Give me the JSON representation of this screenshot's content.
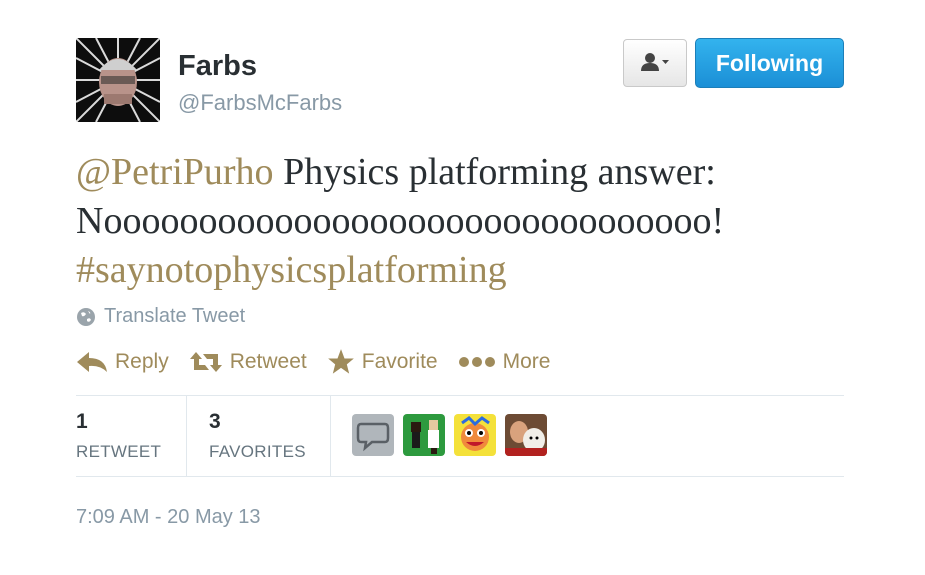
{
  "author": {
    "name": "Farbs",
    "handle": "@FarbsMcFarbs"
  },
  "buttons": {
    "user_menu_icon": "user-dropdown-icon",
    "follow_label": "Following"
  },
  "tweet": {
    "mention": "@PetriPurho",
    "text_line1_rest": " Physics platforming answer:",
    "text_line2": "Noooooooooooooooooooooooooooooooo!",
    "hashtag": "#saynotophysicsplatforming"
  },
  "translate_label": "Translate Tweet",
  "actions": {
    "reply": "Reply",
    "retweet": "Retweet",
    "favorite": "Favorite",
    "more": "More"
  },
  "stats": {
    "retweets_count": "1",
    "retweets_label": "RETWEET",
    "favorites_count": "3",
    "favorites_label": "FAVORITES"
  },
  "timestamp": "7:09 AM - 20 May 13",
  "colors": {
    "link": "#9f8b5b",
    "follow_button": "#1b8fd6"
  }
}
